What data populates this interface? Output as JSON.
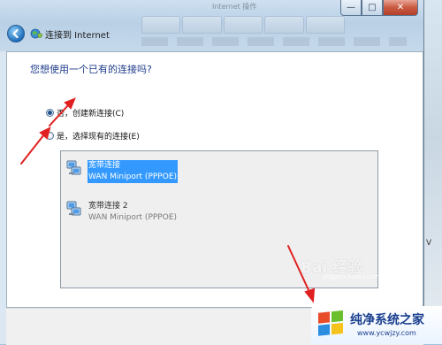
{
  "window": {
    "title": "连接到 Internet",
    "ghost_title": "Internet 操作",
    "controls": {
      "minimize": "—",
      "maximize": "□",
      "close": "✕"
    }
  },
  "main": {
    "question": "您想使用一个已有的连接吗?",
    "options": [
      {
        "label": "否，创建新连接(C)",
        "selected": true
      },
      {
        "label": "是，选择现有的连接(E)",
        "selected": false
      }
    ],
    "connections": [
      {
        "name": "宽带连接",
        "device": "WAN Miniport (PPPOE)",
        "selected": true
      },
      {
        "name": "宽带连接 2",
        "device": "WAN Miniport (PPPOE)",
        "selected": false
      }
    ]
  },
  "background": {
    "right_letter": "V"
  },
  "watermarks": {
    "baidu": "Bai 经验",
    "baidu_sub": "jingyan.baidu.com",
    "site_name": "纯净系统之家",
    "site_url": "www.ycwjzy.com"
  },
  "colors": {
    "question_text": "#1f3d8a",
    "selection": "#3399ff",
    "annotation_arrow": "#e02020",
    "close_button": "#c85a40"
  }
}
